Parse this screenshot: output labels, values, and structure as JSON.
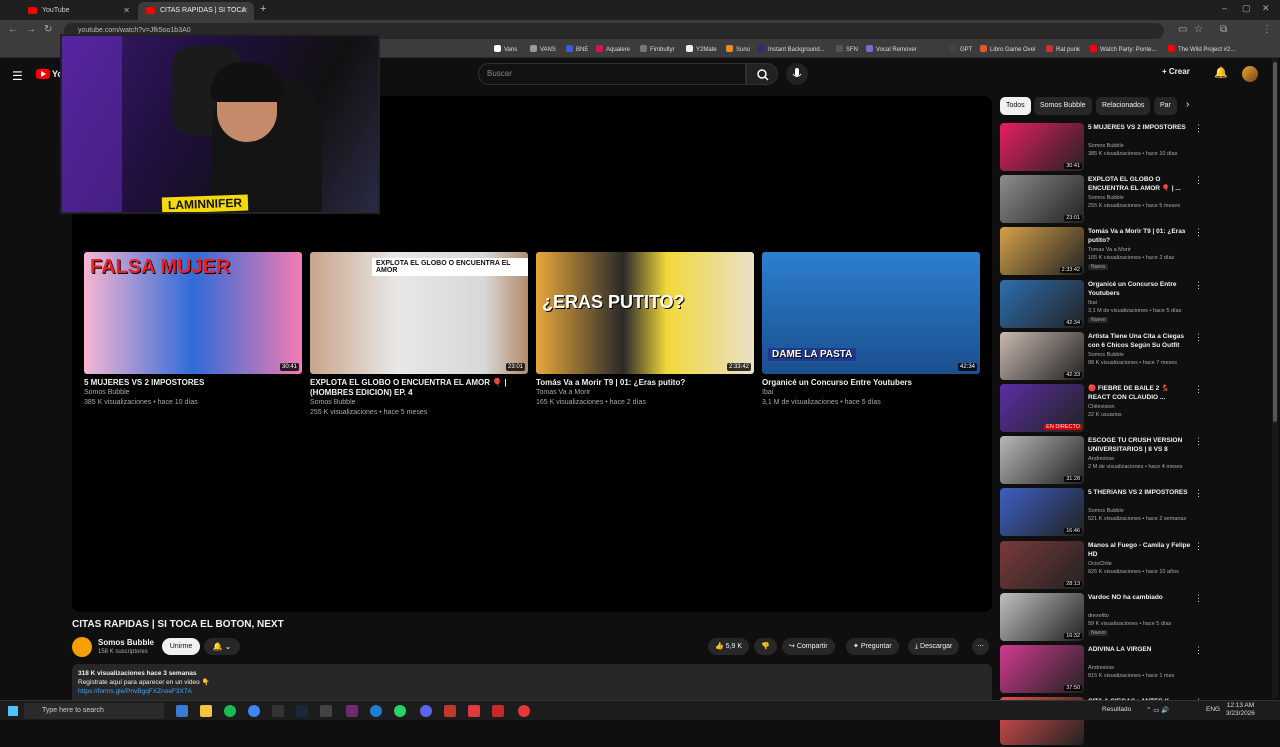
{
  "browser": {
    "tabs": [
      {
        "label": "YouTube"
      },
      {
        "label": "CITAS RAPIDAS | SI TOCA EL BO"
      }
    ],
    "url": "youtube.com/watch?v=Jfk5oo1b3A0",
    "bookmarks": [
      "Vans",
      "VANS",
      "BNE",
      "Aqualere",
      "Fimbultyr",
      "Y2Mate",
      "Suno",
      "Instant Background...",
      "SFN",
      "Vocal Remover",
      "○",
      "GPT",
      "Libro Game Ovel",
      "Rat punk",
      "Watch Party: Ponte...",
      "The Wild Project #2..."
    ]
  },
  "header": {
    "search_placeholder": "Buscar",
    "create_label": "Crear"
  },
  "webcam": {
    "overlay_text": "LAMINNIFER"
  },
  "player_cards": [
    {
      "title": "5 MUJERES VS 2 IMPOSTORES",
      "channel": "Somos Bubble",
      "meta": "385 K visualizaciones • hace 10 días",
      "duration": "30:41",
      "thumb_text": "FALSA MUJER"
    },
    {
      "title": "EXPLOTA EL GLOBO O ENCUENTRA EL AMOR 🎈 | (HOMBRES EDICION) EP. 4",
      "channel": "Somos Bubble",
      "meta": "255 K visualizaciones • hace 5 meses",
      "duration": "23:01",
      "thumb_text": "EXPLOTA EL GLOBO O ENCUENTRA EL AMOR"
    },
    {
      "title": "Tomás Va a Morir T9 | 01: ¿Eras putito?",
      "channel": "Tomas Va a Morir",
      "meta": "165 K visualizaciones • hace 2 días",
      "duration": "2:33:42",
      "thumb_text": "¿ERAS PUTITO?"
    },
    {
      "title": "Organicé un Concurso Entre Youtubers",
      "channel": "Ibai",
      "meta": "3,1 M de visualizaciones • hace 5 días",
      "duration": "42:34",
      "thumb_text": "DAME LA PASTA"
    }
  ],
  "video": {
    "title": "CITAS RAPIDAS | SI TOCA EL BOTON, NEXT",
    "channel": "Somos Bubble",
    "subs": "158 K suscriptores",
    "subscribe_label": "Unirme",
    "likes": "5,9 K",
    "share_label": "Compartir",
    "ask_label": "Preguntar",
    "download_label": "Descargar",
    "desc_line1": "318 K visualizaciones  hace 3 semanas",
    "desc_line2": "Registrate aquí para aparecer en un video 👇",
    "desc_link": "https://forms.gle/PnvBgqFXZnoeF3X7A"
  },
  "chips": [
    "Todos",
    "Somos Bubble",
    "Relacionados",
    "Par"
  ],
  "sidebar": [
    {
      "title": "5 MUJERES VS 2 IMPOSTORES",
      "channel": "Somos Bubble",
      "meta": "385 K visualizaciones • hace 10 días",
      "duration": "30:41",
      "badge": "",
      "color": "#e91e63"
    },
    {
      "title": "EXPLOTA EL GLOBO O ENCUENTRA EL AMOR 🎈 | ...",
      "channel": "Somos Bubble",
      "meta": "255 K visualizaciones • hace 5 meses",
      "duration": "23:01",
      "badge": "",
      "color": "#8d8d8d"
    },
    {
      "title": "Tomás Va a Morir T9 | 01: ¿Eras putito?",
      "channel": "Tomas Va a Morir",
      "meta": "165 K visualizaciones • hace 2 días",
      "duration": "2:33:42",
      "badge": "Nuevo",
      "color": "#d6a24a"
    },
    {
      "title": "Organicé un Concurso Entre Youtubers",
      "channel": "Ibai",
      "meta": "3,1 M de visualizaciones • hace 5 días",
      "duration": "42:34",
      "badge": "Nuevo",
      "color": "#2d6fb0"
    },
    {
      "title": "Artista Tiene Una Cita a Ciegas con 6 Chicos Según Su Outfit",
      "channel": "Somos Bubble",
      "meta": "88 K visualizaciones • hace 7 meses",
      "duration": "42:33",
      "badge": "",
      "color": "#c9b9b0"
    },
    {
      "title": "🔴 FIEBRE DE BAILE 2 💃 REACT CON CLAUDIO ...",
      "channel": "Chilevision",
      "meta": "22 K usuarios",
      "duration": "EN DIRECTO",
      "badge": "",
      "color": "#5a2ea6"
    },
    {
      "title": "ESCOGE TU CRUSH VERSION UNIVERSITARIOS | 8 VS 8",
      "channel": "Andrestow",
      "meta": "2 M de visualizaciones • hace 4 meses",
      "duration": "31:28",
      "badge": "",
      "color": "#b8b8b8"
    },
    {
      "title": "5 THERIANS VS 2 IMPOSTORES",
      "channel": "Somos Bubble",
      "meta": "521 K visualizaciones • hace 2 semanas",
      "duration": "16:46",
      "badge": "",
      "color": "#3d5fc4"
    },
    {
      "title": "Manos al Fuego - Camila y Felipe HD",
      "channel": "OcioChile",
      "meta": "826 K visualizaciones • hace 10 años",
      "duration": "28:13",
      "badge": "",
      "color": "#7a3a3a"
    },
    {
      "title": "Vardoc NO ha cambiado",
      "channel": "drexelito",
      "meta": "59 K visualizaciones • hace 5 días",
      "duration": "16:32",
      "badge": "Nuevo",
      "color": "#c0c0c0"
    },
    {
      "title": "ADIVINA LA VIRGEN",
      "channel": "Andrestow",
      "meta": "815 K visualizaciones • hace 1 mes",
      "duration": "37:50",
      "badge": "",
      "color": "#d23a8f"
    },
    {
      "title": "CITA A CIEGAS : ANTES Y",
      "channel": "",
      "meta": "",
      "duration": "",
      "badge": "",
      "color": "#e05050"
    }
  ],
  "taskbar": {
    "search_placeholder": "Type here to search",
    "weather": "Resultado",
    "lang": "ENG",
    "time": "12:13 AM",
    "date": "3/23/2026"
  }
}
